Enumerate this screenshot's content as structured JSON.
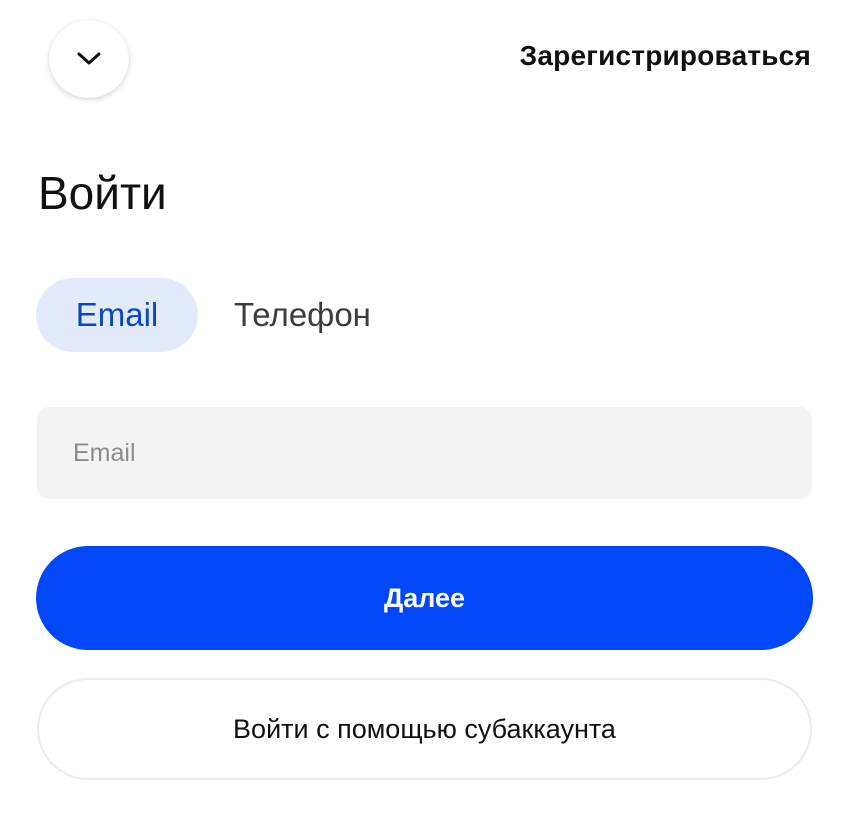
{
  "header": {
    "back_icon": "chevron-down-icon",
    "signup_label": "Зарегистрироваться"
  },
  "title": "Войти",
  "tabs": [
    {
      "label": "Email",
      "active": true
    },
    {
      "label": "Телефон",
      "active": false
    }
  ],
  "email_input": {
    "placeholder": "Email",
    "value": ""
  },
  "buttons": {
    "next_label": "Далее",
    "subaccount_label": "Войти с помощью субаккаунта"
  },
  "colors": {
    "primary": "#0047f9",
    "tab_active_bg": "#e3ebfb",
    "tab_active_text": "#0b46c8",
    "input_bg": "#f3f3f3"
  }
}
